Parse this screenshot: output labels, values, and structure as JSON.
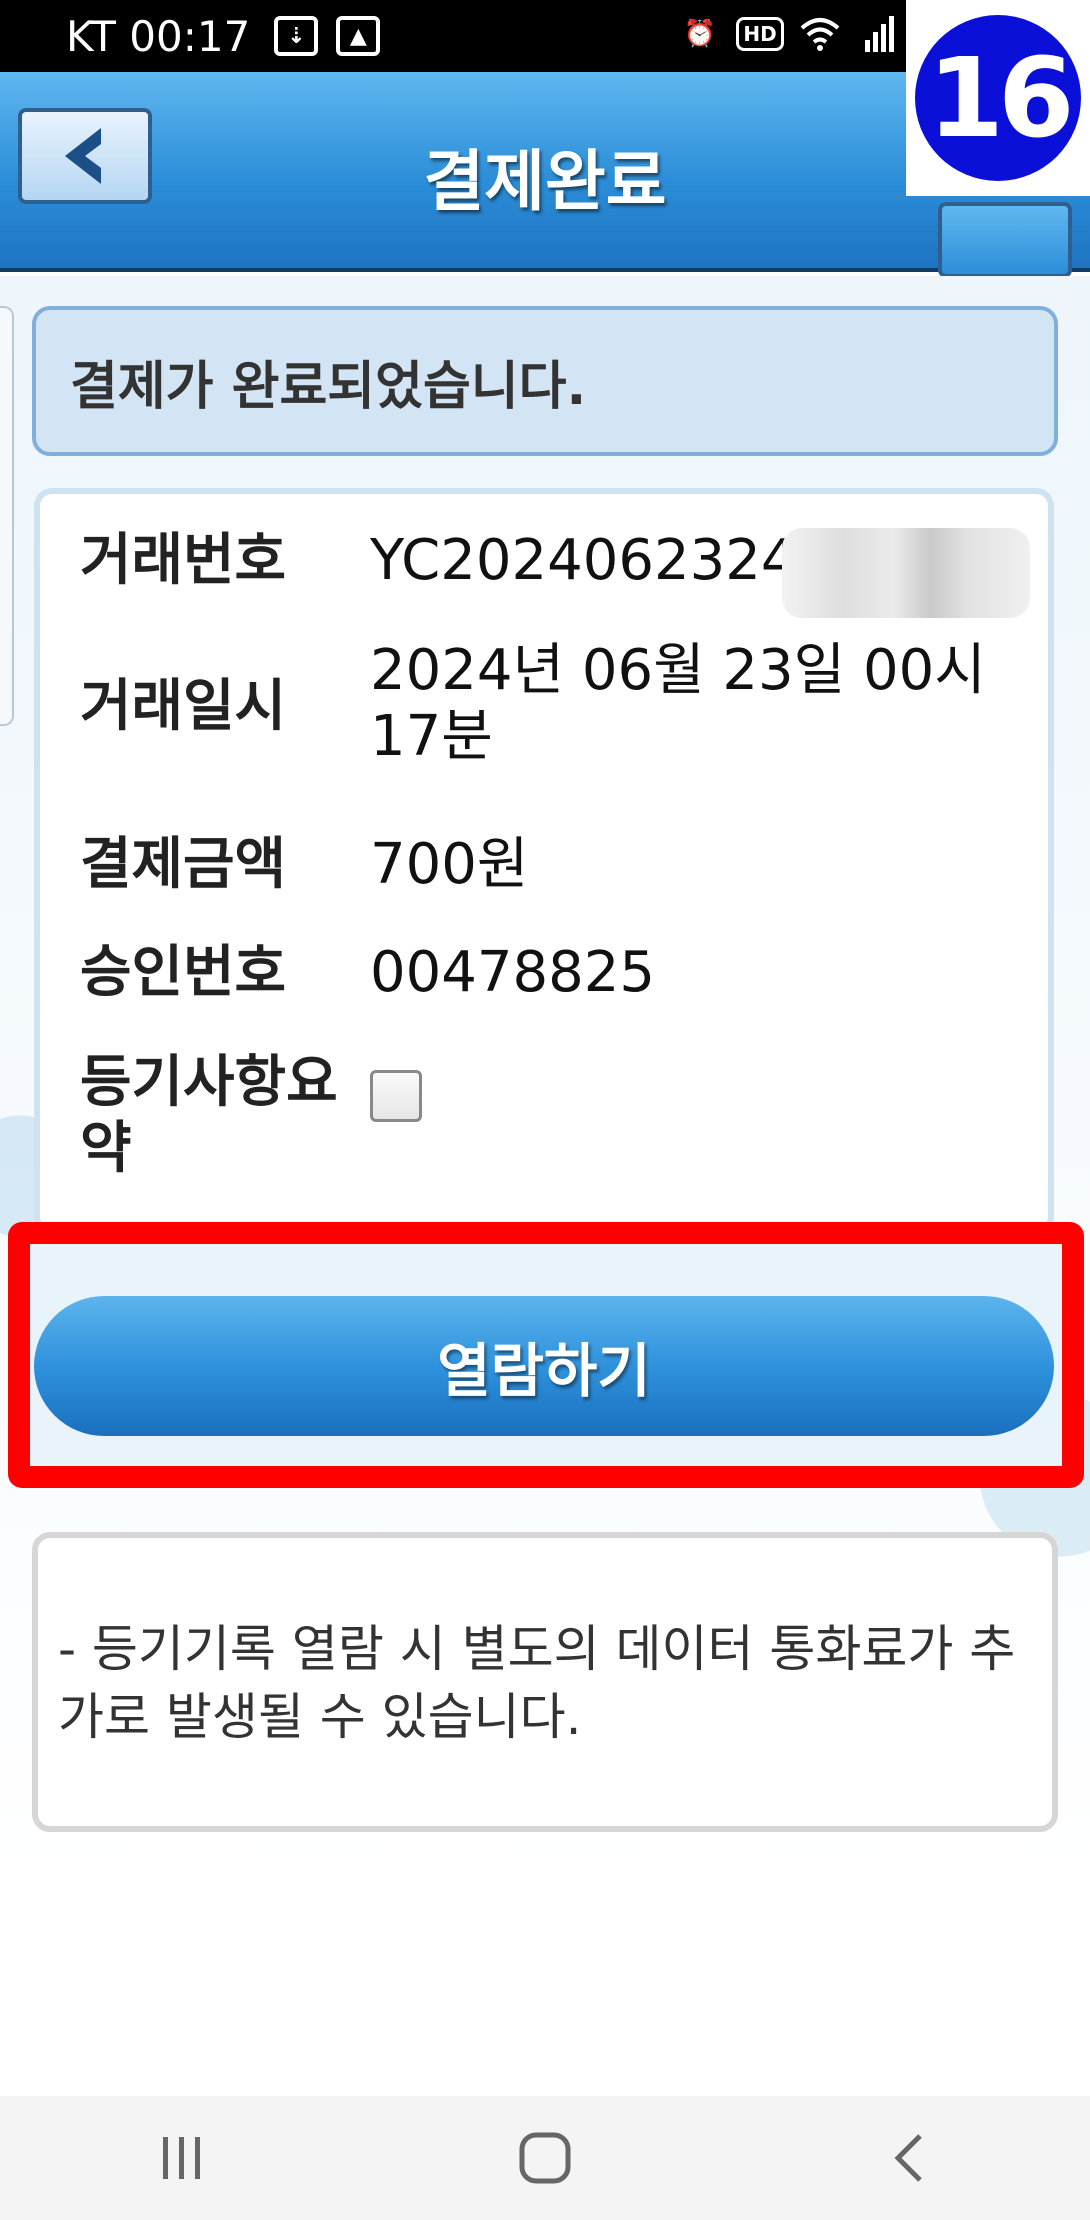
{
  "status_bar": {
    "carrier_time": "KT 00:17",
    "hd": "HD"
  },
  "header": {
    "title": "결제완료",
    "step_badge": "16"
  },
  "message": {
    "text": "결제가 완료되었습니다."
  },
  "info": {
    "rows": [
      {
        "label": "거래번호",
        "value": "YC20240623241"
      },
      {
        "label": "거래일시",
        "value": "2024년 06월 23일 00시 17분"
      },
      {
        "label": "결제금액",
        "value": "700원"
      },
      {
        "label": "승인번호",
        "value": "00478825"
      },
      {
        "label": "등기사항요약",
        "value": ""
      }
    ],
    "summary_checked": false
  },
  "actions": {
    "view_button": "열람하기"
  },
  "notice": {
    "text": "- 등기기록 열람 시 별도의 데이터 통화료가 추가로 발생될 수 있습니다."
  },
  "colors": {
    "header_blue": "#2c8ed8",
    "highlight_red": "#ff0000",
    "step_badge_blue": "#0a10d8"
  },
  "icons": {
    "back": "chevron-left-icon",
    "nav_recent": "recent-apps-icon",
    "nav_home": "home-icon",
    "nav_back": "back-icon"
  }
}
